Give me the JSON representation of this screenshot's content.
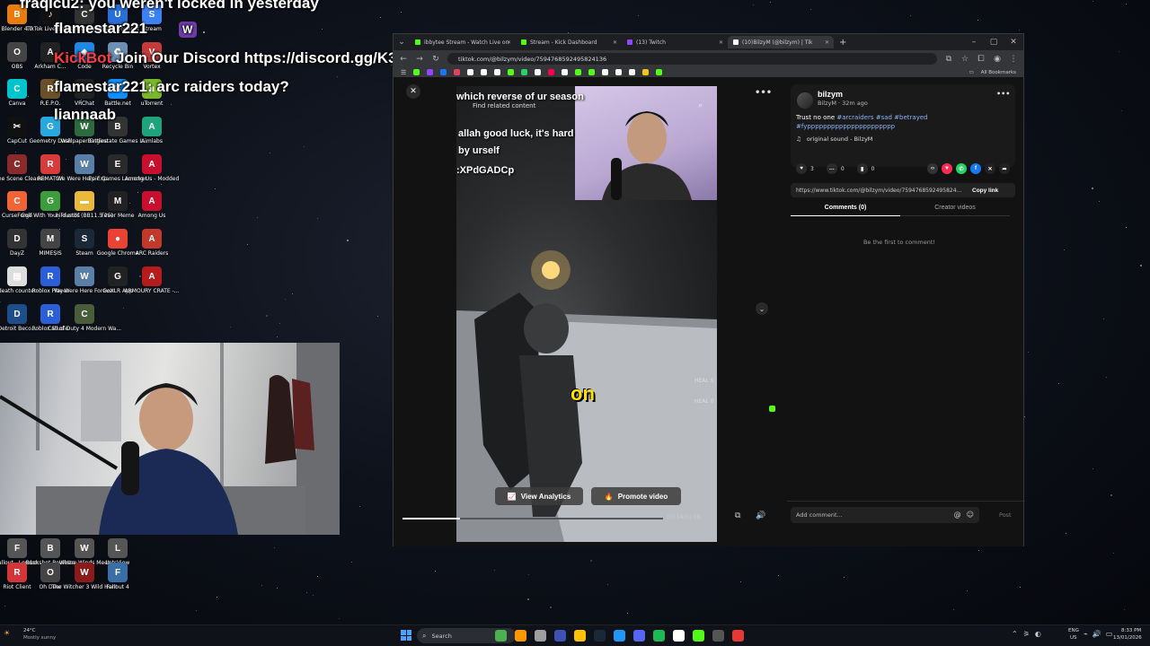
{
  "chat": {
    "lines": [
      {
        "user": "fraqicu2",
        "text": "you weren't locked in yesterday"
      },
      {
        "user": "flamestar221",
        "text": ""
      },
      {
        "user": "KickBot",
        "text": "Join Our Discord https://discord.gg/K3XPdGADCp"
      },
      {
        "user": "flamestar221",
        "text": "arc raiders today?"
      },
      {
        "user": "liannaab",
        "text": ""
      }
    ]
  },
  "desktop": {
    "icons": [
      {
        "label": "Blender 4.0",
        "color": "#e87d0d",
        "glyph": "B"
      },
      {
        "label": "TikTok Live Studio",
        "color": "#111111",
        "glyph": "♪"
      },
      {
        "label": "Call of Duty",
        "color": "#333333",
        "glyph": "C"
      },
      {
        "label": "Ubisoft Connect",
        "color": "#2a6fd6",
        "glyph": "U"
      },
      {
        "label": "Stream",
        "color": "#3b82f6",
        "glyph": "S"
      },
      {
        "label": "OBS",
        "color": "#444444",
        "glyph": "O"
      },
      {
        "label": "Arkham C...",
        "color": "#222222",
        "glyph": "A"
      },
      {
        "label": "Code",
        "color": "#1e88e5",
        "glyph": "◆"
      },
      {
        "label": "Recycle Bin",
        "color": "#6c8fb5",
        "glyph": "♻"
      },
      {
        "label": "Vortex",
        "color": "#c43a3a",
        "glyph": "V"
      },
      {
        "label": "Canva",
        "color": "#00c4cc",
        "glyph": "C"
      },
      {
        "label": "R.E.P.O.",
        "color": "#6b4f2a",
        "glyph": "R"
      },
      {
        "label": "VRChat",
        "color": "#222222",
        "glyph": "V"
      },
      {
        "label": "Battle.net",
        "color": "#148eff",
        "glyph": "B"
      },
      {
        "label": "uTorrent",
        "color": "#78b82a",
        "glyph": "µ"
      },
      {
        "label": "CapCut",
        "color": "#111111",
        "glyph": "✂"
      },
      {
        "label": "Geometry Dash",
        "color": "#29a8e0",
        "glyph": "G"
      },
      {
        "label": "Wallpaper Engine",
        "color": "#2d6a3f",
        "glyph": "W"
      },
      {
        "label": "Battlestate Games L...",
        "color": "#333333",
        "glyph": "B"
      },
      {
        "label": "Aimlabs",
        "color": "#1fa37a",
        "glyph": "A"
      },
      {
        "label": "Crime Scene Cleaner",
        "color": "#8a2a2a",
        "glyph": "C"
      },
      {
        "label": "REMATCH",
        "color": "#d93b3b",
        "glyph": "R"
      },
      {
        "label": "We Were Here Exp...",
        "color": "#5a7fa6",
        "glyph": "W"
      },
      {
        "label": "Epic Games Launcher",
        "color": "#2a2a2a",
        "glyph": "E"
      },
      {
        "label": "Among Us - Modded",
        "color": "#c8102e",
        "glyph": "A"
      },
      {
        "label": "CurseForge",
        "color": "#f16436",
        "glyph": "C"
      },
      {
        "label": "Golf With Your Friends",
        "color": "#3b9e3b",
        "glyph": "G"
      },
      {
        "label": "hiidustbf (BB11.5.25)",
        "color": "#e8b93a",
        "glyph": "▬"
      },
      {
        "label": "Fever Meme",
        "color": "#222222",
        "glyph": "M"
      },
      {
        "label": "Among Us",
        "color": "#c8102e",
        "glyph": "A"
      },
      {
        "label": "DayZ",
        "color": "#333333",
        "glyph": "D"
      },
      {
        "label": "MIMESIS",
        "color": "#444444",
        "glyph": "M"
      },
      {
        "label": "Steam",
        "color": "#1b2838",
        "glyph": "S"
      },
      {
        "label": "Google Chrome",
        "color": "#ea4335",
        "glyph": "●"
      },
      {
        "label": "ARC Raiders",
        "color": "#c0392b",
        "glyph": "A"
      },
      {
        "label": "death counter",
        "color": "#dddddd",
        "glyph": "▤"
      },
      {
        "label": "Roblox Player",
        "color": "#2b5fd9",
        "glyph": "R"
      },
      {
        "label": "We Were Here Forever",
        "color": "#5a7fa6",
        "glyph": "W"
      },
      {
        "label": "GoXLR App",
        "color": "#222222",
        "glyph": "G"
      },
      {
        "label": "ARMOURY CRATE -...",
        "color": "#b71c1c",
        "glyph": "A"
      },
      {
        "label": "Detroit Beco...",
        "color": "#1d4e89",
        "glyph": "D"
      },
      {
        "label": "Roblox Studio",
        "color": "#2b5fd9",
        "glyph": "R"
      },
      {
        "label": "Call of Duty 4 Modern Wa...",
        "color": "#4a5d3a",
        "glyph": "C"
      },
      {
        "label": "Fallout - London",
        "color": "#555555",
        "glyph": "F"
      },
      {
        "label": "Buckshot Roulette",
        "color": "#555555",
        "glyph": "B"
      },
      {
        "label": "Where Winds Meet",
        "color": "#555555",
        "glyph": "W"
      },
      {
        "label": "LetsView",
        "color": "#555555",
        "glyph": "L"
      },
      {
        "label": "Riot Client",
        "color": "#d13639",
        "glyph": "R"
      },
      {
        "label": "Oh Deer",
        "color": "#444444",
        "glyph": "O"
      },
      {
        "label": "The Witcher 3 Wild Hunt",
        "color": "#8b1a1a",
        "glyph": "W"
      },
      {
        "label": "Fallout 4",
        "color": "#3a6ea5",
        "glyph": "F"
      }
    ]
  },
  "browser": {
    "tabs": [
      {
        "label": "ibbytee Stream - Watch Live on",
        "color": "#53fc18"
      },
      {
        "label": "Stream - Kick Dashboard",
        "color": "#53fc18"
      },
      {
        "label": "(13) Twitch",
        "color": "#9146ff"
      },
      {
        "label": "(10)BilzyM (@bilzym) | Tik",
        "color": "#ffffff"
      }
    ],
    "new_tab": "+",
    "url": "tiktok.com/@bilzym/video/7594768592495824136",
    "all_bookmarks": "All Bookmarks",
    "bookmark_colors": [
      "#53fc18",
      "#9146ff",
      "#1877f2",
      "#e4405f",
      "#ffffff",
      "#ffffff",
      "#ffffff",
      "#53fc18",
      "#25d366",
      "#ffffff",
      "#ff0050",
      "#ffffff",
      "#53fc18",
      "#53fc18",
      "#ffffff",
      "#ffffff",
      "#ffffff",
      "#f5c518",
      "#53fc18"
    ]
  },
  "video": {
    "overlay_search": "Find related content",
    "caption_lines": [
      "which reverse of ur season",
      "allah good luck, it's hard",
      "by urself",
      ":XPdGADCp"
    ],
    "subtitle": "on",
    "hud_1": "HEAL S",
    "hud_2": "HEAL 0",
    "view_analytics": "View Analytics",
    "promote_video": "Promote video",
    "time": "00:14/01:08",
    "progress": 0.22
  },
  "panel": {
    "author": "bilzym",
    "meta": "BilzyM · 32m ago",
    "caption_text": "Trust no one ",
    "hashtags": "#arcraiders #sad #betrayed",
    "hashtags_2": "#fypppppppppppppppppppppp",
    "sound": "original sound - BilzyM",
    "likes": "3",
    "comments": "0",
    "saves": "0",
    "link": "https://www.tiktok.com/@bilzym/video/7594768592495824...",
    "copy_link": "Copy link",
    "tab_comments": "Comments (0)",
    "tab_creator": "Creator videos",
    "empty": "Be the first to comment!",
    "add_comment": "Add comment...",
    "post": "Post"
  },
  "taskbar": {
    "weather_temp": "24°C",
    "weather_desc": "Mostly sunny",
    "search": "Search",
    "lang_1": "ENG",
    "lang_2": "US",
    "time": "8:33 PM",
    "date": "13/01/2026"
  }
}
